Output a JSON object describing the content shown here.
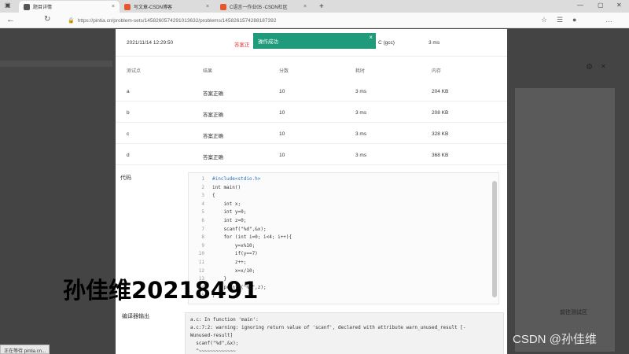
{
  "browser": {
    "tabs": [
      {
        "label": "题目详情",
        "icon_color": "#555555",
        "active": true
      },
      {
        "label": "写文章-CSDN博客",
        "icon_color": "#e4572e",
        "active": false
      },
      {
        "label": "C语言一作业05 -CSDN社区",
        "icon_color": "#e4572e",
        "active": false
      }
    ],
    "new_tab": "+",
    "url": "https://pintia.cn/problem-sets/1458260574291013632/problems/1458261574288187392"
  },
  "result": {
    "submit_time": "2021/11/14 12:29:50",
    "status": "答案正",
    "compiler": "C (gcc)",
    "time": "3 ms"
  },
  "toast": {
    "text": "操作成功",
    "close": "×",
    "color": "#1f9b7b"
  },
  "table": {
    "headers": [
      "测试点",
      "结果",
      "分数",
      "耗时",
      "内存"
    ],
    "rows": [
      [
        "a",
        "答案正确",
        "10",
        "3 ms",
        "204 KB"
      ],
      [
        "b",
        "答案正确",
        "10",
        "3 ms",
        "208 KB"
      ],
      [
        "c",
        "答案正确",
        "10",
        "3 ms",
        "328 KB"
      ],
      [
        "d",
        "答案正确",
        "10",
        "3 ms",
        "368 KB"
      ]
    ]
  },
  "code": {
    "label": "代码",
    "lines": [
      {
        "n": "1",
        "t": "#include<stdio.h>"
      },
      {
        "n": "2",
        "t": "int main()"
      },
      {
        "n": "3",
        "t": "{"
      },
      {
        "n": "4",
        "t": "    int x;"
      },
      {
        "n": "5",
        "t": "    int y=0;"
      },
      {
        "n": "6",
        "t": "    int z=0;"
      },
      {
        "n": "7",
        "t": "    scanf(\"%d\",&x);"
      },
      {
        "n": "8",
        "t": "    for (int i=0; i<4; i++){"
      },
      {
        "n": "9",
        "t": "        y=x%10;"
      },
      {
        "n": "10",
        "t": "        if(y==7)"
      },
      {
        "n": "11",
        "t": "        z++;"
      },
      {
        "n": "12",
        "t": "        x=x/10;"
      },
      {
        "n": "13",
        "t": "    }"
      },
      {
        "n": "14",
        "t": "    printf(\"%d\",z);"
      },
      {
        "n": "15",
        "t": "}"
      }
    ]
  },
  "compiler_output": {
    "label": "编译器输出",
    "lines": [
      "a.c: In function 'main':",
      "a.c:7:2: warning: ignoring return value of 'scanf', declared with attribute warn_unused_result [-",
      "Wunused-result]",
      "  scanf(\"%d\",&x);",
      "  ^~~~~~~~~~~~~~"
    ]
  },
  "backdrop": {
    "button": "前往测试区"
  },
  "overlay": {
    "name": "孙佳维20218491",
    "watermark": "CSDN @孙佳维"
  },
  "status_bar": "正在等待 pintia.cn..."
}
